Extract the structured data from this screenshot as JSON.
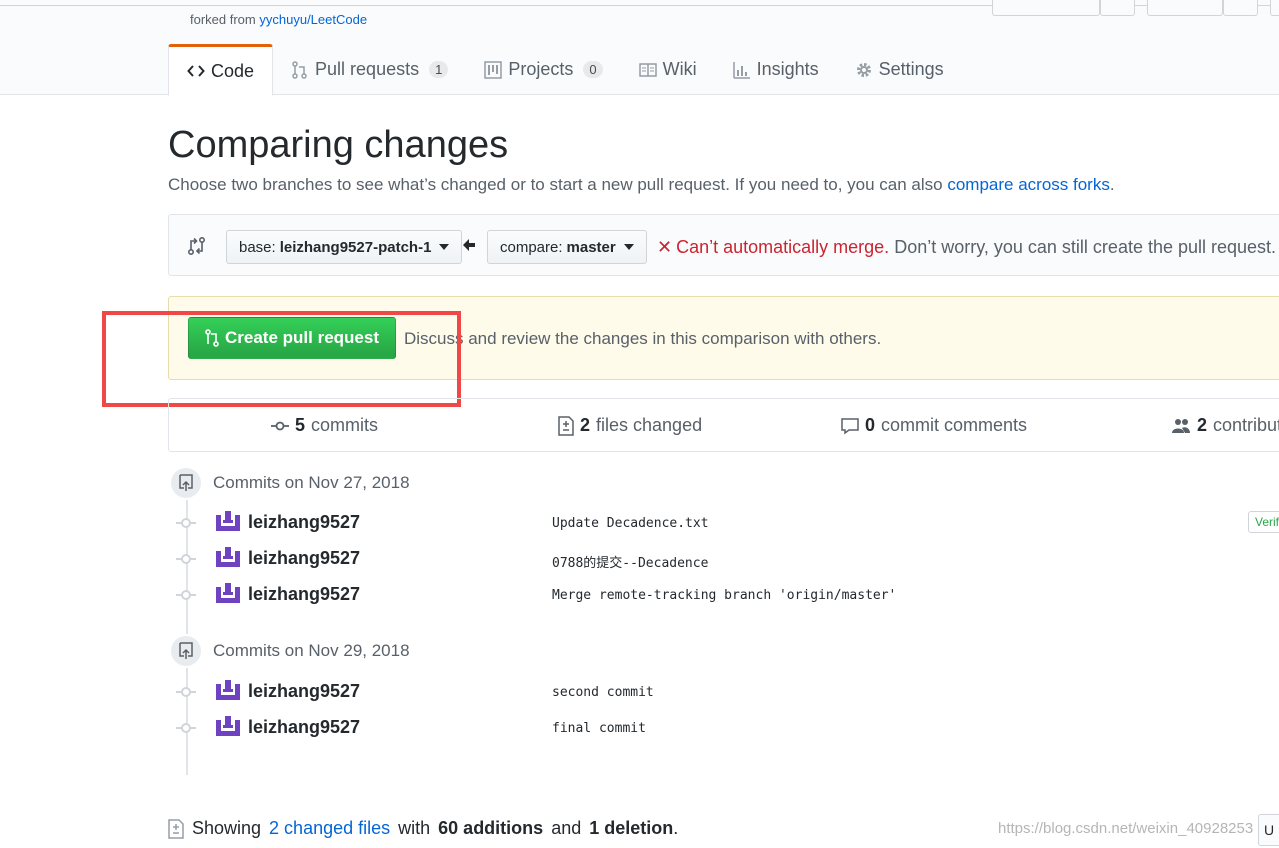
{
  "repo": {
    "forked_prefix": "forked from",
    "forked_link": "yychuyu/LeetCode"
  },
  "tabs": [
    {
      "label": "Code",
      "icon": "code-icon",
      "selected": true
    },
    {
      "label": "Pull requests",
      "icon": "pull-request-icon",
      "count": "1"
    },
    {
      "label": "Projects",
      "icon": "project-icon",
      "count": "0"
    },
    {
      "label": "Wiki",
      "icon": "book-icon"
    },
    {
      "label": "Insights",
      "icon": "graph-icon"
    },
    {
      "label": "Settings",
      "icon": "gear-icon"
    }
  ],
  "page": {
    "title": "Comparing changes",
    "subtitle": "Choose two branches to see what’s changed or to start a new pull request. If you need to, you can also",
    "subtitle_link": "compare across forks",
    "subtitle_end": "."
  },
  "range": {
    "base_prefix": "base:",
    "base_branch": "leizhang9527-patch-1",
    "compare_prefix": "compare:",
    "compare_branch": "master",
    "merge_status": "Can’t automatically merge.",
    "merge_note": "Don’t worry, you can still create the pull request."
  },
  "banner": {
    "create_button": "Create pull request",
    "text": "Discuss and review the changes in this comparison with others."
  },
  "summary": {
    "commits_count": "5",
    "commits_label": "commits",
    "files_count": "2",
    "files_label": "files changed",
    "comments_count": "0",
    "comments_label": "commit comments",
    "contributors_count": "2",
    "contributors_label": "contribut"
  },
  "commit_groups": [
    {
      "label": "Commits on Nov 27, 2018",
      "commits": [
        {
          "author": "leizhang9527",
          "message": "Update Decadence.txt",
          "badge": "Verif"
        },
        {
          "author": "leizhang9527",
          "message": "0788的提交--Decadence"
        },
        {
          "author": "leizhang9527",
          "message": "Merge remote-tracking branch 'origin/master'"
        }
      ]
    },
    {
      "label": "Commits on Nov 29, 2018",
      "commits": [
        {
          "author": "leizhang9527",
          "message": "second commit"
        },
        {
          "author": "leizhang9527",
          "message": "final commit"
        }
      ]
    }
  ],
  "toc": {
    "prefix": "Showing",
    "link": "2 changed files",
    "middle": "with",
    "additions": "60 additions",
    "and": "and",
    "deletions": "1 deletion",
    "end": "."
  },
  "watermark": "https://blog.csdn.net/weixin_40928253",
  "corner_button": "U",
  "colors": {
    "accent_tab": "#e36209",
    "link": "#0366d6",
    "danger": "#cb2431",
    "primary_button": "#28a745",
    "highlight_box": "#f04747",
    "avatar": "#6f42c1"
  }
}
